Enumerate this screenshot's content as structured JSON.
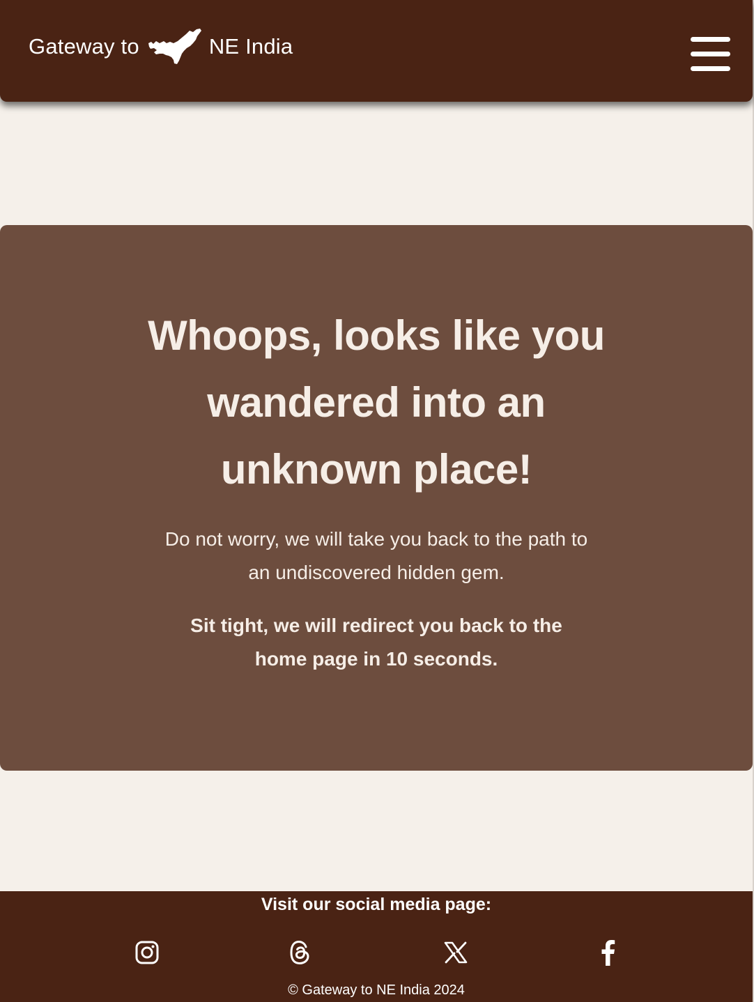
{
  "header": {
    "brand_prefix": "Gateway to",
    "brand_suffix": "NE India",
    "logo_icon": "assam-map-icon",
    "menu_icon": "hamburger-menu-icon"
  },
  "error": {
    "title": "Whoops, looks like you wandered into an unknown place!",
    "message": "Do not worry, we will take you back to the path to an undiscovered hidden gem.",
    "redirect_notice": "Sit tight, we will redirect you back to the home page in 10 seconds."
  },
  "footer": {
    "title": "Visit our social media page:",
    "social": [
      {
        "name": "Instagram",
        "icon": "instagram-icon"
      },
      {
        "name": "Threads",
        "icon": "threads-icon"
      },
      {
        "name": "X",
        "icon": "x-icon"
      },
      {
        "name": "Facebook",
        "icon": "facebook-icon"
      }
    ],
    "copyright": "© Gateway to NE India 2024"
  },
  "colors": {
    "header_bg": "#4a2314",
    "card_bg": "#6d4d3e",
    "page_bg": "#f5f0ea",
    "text_light": "#f6eee7"
  }
}
